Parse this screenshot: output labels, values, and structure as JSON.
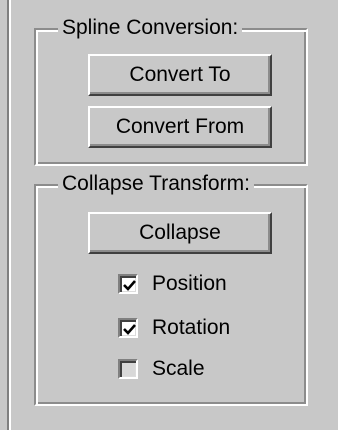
{
  "spline_conversion": {
    "legend": "Spline Conversion:",
    "convert_to_label": "Convert To",
    "convert_from_label": "Convert From"
  },
  "collapse_transform": {
    "legend": "Collapse Transform:",
    "collapse_label": "Collapse",
    "options": [
      {
        "label": "Position",
        "checked": true
      },
      {
        "label": "Rotation",
        "checked": true
      },
      {
        "label": "Scale",
        "checked": false
      }
    ]
  },
  "colors": {
    "panel_bg": "#c8c8c8",
    "shadow": "#8c8c8c",
    "highlight": "#ffffff"
  }
}
